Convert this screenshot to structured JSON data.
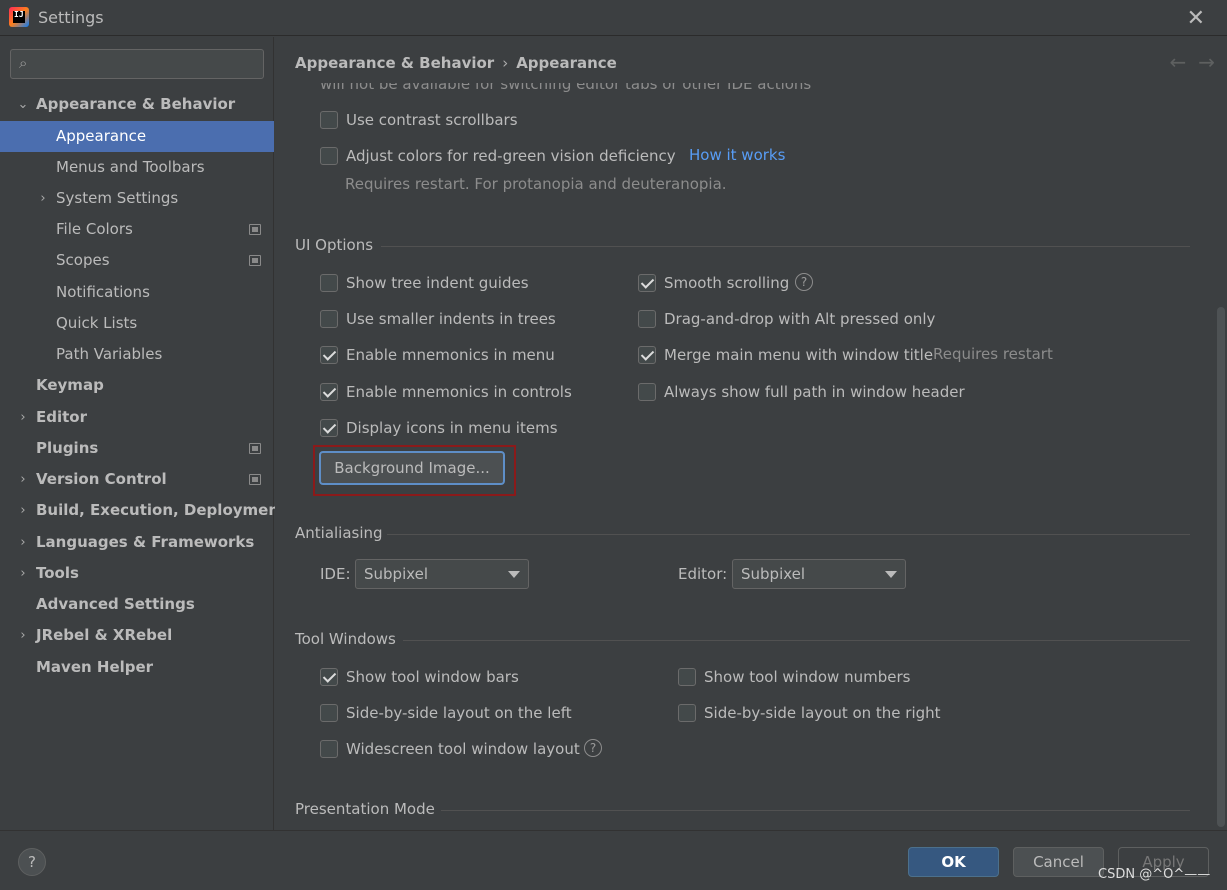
{
  "window": {
    "title": "Settings",
    "app_icon_text": "IJ",
    "close_symbol": "✕"
  },
  "search": {
    "placeholder": "",
    "icon": "search-icon"
  },
  "sidebar": {
    "items": [
      {
        "label": "Appearance & Behavior",
        "expander": "⌄",
        "bold": true
      },
      {
        "label": "Appearance",
        "selected": true
      },
      {
        "label": "Menus and Toolbars"
      },
      {
        "label": "System Settings",
        "expander": "›"
      },
      {
        "label": "File Colors",
        "project_icon": true
      },
      {
        "label": "Scopes",
        "project_icon": true
      },
      {
        "label": "Notifications"
      },
      {
        "label": "Quick Lists"
      },
      {
        "label": "Path Variables"
      },
      {
        "label": "Keymap",
        "bold": true
      },
      {
        "label": "Editor",
        "expander": "›",
        "bold": true
      },
      {
        "label": "Plugins",
        "bold": true,
        "project_icon": true
      },
      {
        "label": "Version Control",
        "expander": "›",
        "bold": true,
        "project_icon": true
      },
      {
        "label": "Build, Execution, Deployment",
        "expander": "›",
        "bold": true
      },
      {
        "label": "Languages & Frameworks",
        "expander": "›",
        "bold": true
      },
      {
        "label": "Tools",
        "expander": "›",
        "bold": true
      },
      {
        "label": "Advanced Settings",
        "bold": true
      },
      {
        "label": "JRebel & XRebel",
        "expander": "›",
        "bold": true
      },
      {
        "label": "Maven Helper",
        "bold": true
      }
    ]
  },
  "breadcrumb": {
    "parent": "Appearance & Behavior",
    "separator": "›",
    "current": "Appearance"
  },
  "nav": {
    "back": "←",
    "forward": "→"
  },
  "top_section": {
    "cut_text": "will not be available for switching editor tabs or other IDE actions",
    "contrast_scrollbars": {
      "label": "Use contrast scrollbars",
      "checked": false
    },
    "red_green": {
      "label": "Adjust colors for red-green vision deficiency",
      "checked": false,
      "link": "How it works",
      "hint": "Requires restart. For protanopia and deuteranopia."
    }
  },
  "ui_options": {
    "title": "UI Options",
    "left": [
      {
        "label": "Show tree indent guides",
        "checked": false
      },
      {
        "label": "Use smaller indents in trees",
        "checked": false
      },
      {
        "label": "Enable mnemonics in menu",
        "checked": true
      },
      {
        "label": "Enable mnemonics in controls",
        "checked": true
      },
      {
        "label": "Display icons in menu items",
        "checked": true
      }
    ],
    "right": [
      {
        "label": "Smooth scrolling",
        "checked": true,
        "help": "?"
      },
      {
        "label": "Drag-and-drop with Alt pressed only",
        "checked": false
      },
      {
        "label": "Merge main menu with window title",
        "checked": true,
        "hint": "Requires restart"
      },
      {
        "label": "Always show full path in window header",
        "checked": false
      }
    ],
    "background_image_button": "Background Image..."
  },
  "antialiasing": {
    "title": "Antialiasing",
    "ide_label": "IDE:",
    "ide_value": "Subpixel",
    "editor_label": "Editor:",
    "editor_value": "Subpixel"
  },
  "tool_windows": {
    "title": "Tool Windows",
    "left": [
      {
        "label": "Show tool window bars",
        "checked": true
      },
      {
        "label": "Side-by-side layout on the left",
        "checked": false
      },
      {
        "label": "Widescreen tool window layout",
        "checked": false,
        "help": "?"
      }
    ],
    "right": [
      {
        "label": "Show tool window numbers",
        "checked": false
      },
      {
        "label": "Side-by-side layout on the right",
        "checked": false
      }
    ]
  },
  "presentation_mode": {
    "title": "Presentation Mode"
  },
  "footer": {
    "help": "?",
    "ok": "OK",
    "cancel": "Cancel",
    "apply": "Apply"
  },
  "watermark": "CSDN @^O^——",
  "colors": {
    "accent": "#4b6eaf",
    "link": "#589df6",
    "ok_button": "#365880",
    "highlight_box": "#8b1a1a",
    "background": "#3c3f41"
  }
}
